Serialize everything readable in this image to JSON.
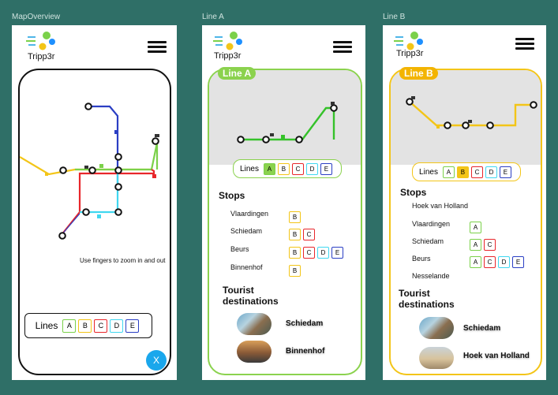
{
  "frames": {
    "overview": "MapOverview",
    "line_a": "Line A",
    "line_b": "Line B"
  },
  "app": {
    "name": "Tripp3r"
  },
  "colors": {
    "line_A": "#7bd14a",
    "line_B": "#f3c518",
    "line_C": "#e8262b",
    "line_D": "#40d7f0",
    "line_E": "#2b3fc4",
    "background": "#2f6f67"
  },
  "overview": {
    "hint": "Use fingers to zoom in and out",
    "lines_label": "Lines",
    "chips": [
      "A",
      "B",
      "C",
      "D",
      "E"
    ],
    "close_label": "X"
  },
  "line_a": {
    "badge": "Line A",
    "lines_label": "Lines",
    "chips": [
      "A",
      "B",
      "C",
      "D",
      "E"
    ],
    "stops_title": "Stops",
    "stops": [
      {
        "name": "Vlaardingen",
        "lines": [
          "B"
        ]
      },
      {
        "name": "Schiedam",
        "lines": [
          "B",
          "C"
        ]
      },
      {
        "name": "Beurs",
        "lines": [
          "B",
          "C",
          "D",
          "E"
        ]
      },
      {
        "name": "Binnenhof",
        "lines": [
          "B"
        ]
      }
    ],
    "tourist_title_1": "Tourist",
    "tourist_title_2": "destinations",
    "destinations": [
      "Schiedam",
      "Binnenhof"
    ]
  },
  "line_b": {
    "badge": "Line B",
    "lines_label": "Lines",
    "chips": [
      "A",
      "B",
      "C",
      "D",
      "E"
    ],
    "stops_title": "Stops",
    "stops": [
      {
        "name": "Hoek van Holland",
        "lines": []
      },
      {
        "name": "Vlaardingen",
        "lines": [
          "A"
        ]
      },
      {
        "name": "Schiedam",
        "lines": [
          "A",
          "C"
        ]
      },
      {
        "name": "Beurs",
        "lines": [
          "A",
          "C",
          "D",
          "E"
        ]
      },
      {
        "name": "Nesselande",
        "lines": []
      }
    ],
    "tourist_title_1": "Tourist",
    "tourist_title_2": "destinations",
    "destinations": [
      "Schiedam",
      "Hoek van Holland"
    ]
  }
}
